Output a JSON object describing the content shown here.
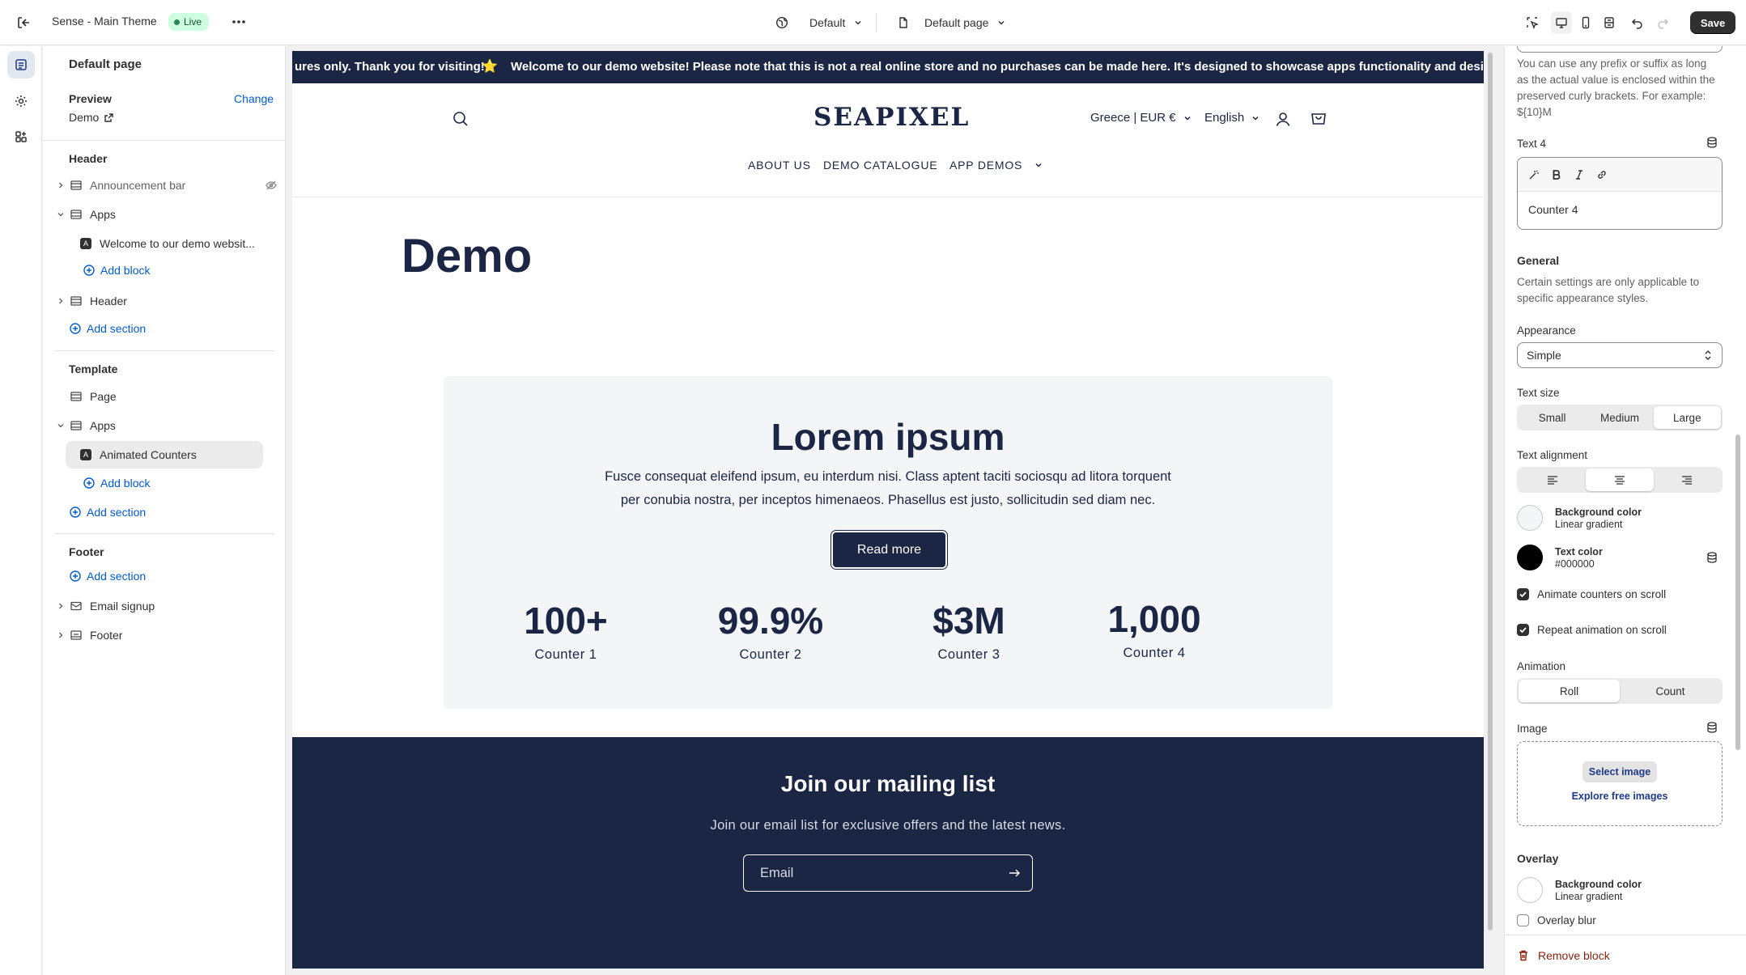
{
  "topbar": {
    "theme_name": "Sense - Main Theme",
    "status": "Live",
    "theme_selector": "Default",
    "page_selector": "Default page",
    "save_label": "Save"
  },
  "sidebar": {
    "title": "Default page",
    "preview_label": "Preview",
    "change_label": "Change",
    "preview_value": "Demo",
    "header_group": "Header",
    "header_items": [
      {
        "label": "Announcement bar"
      },
      {
        "label": "Apps"
      },
      {
        "label": "Welcome to our demo websit..."
      },
      {
        "label": "Add block"
      },
      {
        "label": "Header"
      },
      {
        "label": "Add section"
      }
    ],
    "template_group": "Template",
    "template_items": [
      {
        "label": "Page"
      },
      {
        "label": "Apps"
      },
      {
        "label": "Animated Counters"
      },
      {
        "label": "Add block"
      },
      {
        "label": "Add section"
      }
    ],
    "footer_group": "Footer",
    "footer_items": [
      {
        "label": "Add section"
      },
      {
        "label": "Email signup"
      },
      {
        "label": "Footer"
      }
    ]
  },
  "preview": {
    "announcement_part1": "ures only. Thank you for visiting!",
    "announcement_star": "⭐",
    "announcement_part2": "Welcome to our demo website! Please note that this is not a real online store and no purchases can be made here. It's designed to showcase apps functionality and design feat",
    "logo": "SEAPIXEL",
    "country": "Greece | EUR €",
    "language": "English",
    "nav": [
      "ABOUT US",
      "DEMO CATALOGUE",
      "APP DEMOS"
    ],
    "page_title": "Demo",
    "card": {
      "heading": "Lorem ipsum",
      "text_line1": "Fusce consequat eleifend ipsum, eu interdum nisi. Class aptent taciti sociosqu ad litora torquent",
      "text_line2": "per conubia nostra, per inceptos himenaeos. Phasellus est justo, sollicitudin sed diam nec.",
      "button": "Read more",
      "counters": [
        {
          "value": "100+",
          "label": "Counter 1"
        },
        {
          "value": "99.9%",
          "label": "Counter 2"
        },
        {
          "value": "$3M",
          "label": "Counter 3"
        },
        {
          "value": "1,000",
          "label": "Counter 4"
        }
      ]
    },
    "mailing": {
      "heading": "Join our mailing list",
      "text": "Join our email list for exclusive offers and the latest news.",
      "placeholder": "Email"
    }
  },
  "settings": {
    "help_text_line1": "You can use any prefix or suffix as long",
    "help_text_line2": "as the actual value is enclosed within the",
    "help_text_line3": "preserved curly brackets. For example:",
    "help_text_line4": "${10}M",
    "text4_label": "Text 4",
    "text4_value": "Counter 4",
    "general_heading": "General",
    "general_help_line1": "Certain settings are only applicable to",
    "general_help_line2": "specific appearance styles.",
    "appearance_label": "Appearance",
    "appearance_value": "Simple",
    "text_size_label": "Text size",
    "text_size_options": [
      "Small",
      "Medium",
      "Large"
    ],
    "text_size_selected": "Large",
    "text_alignment_label": "Text alignment",
    "bg_color_label": "Background color",
    "bg_color_value": "Linear gradient",
    "text_color_label": "Text color",
    "text_color_value": "#000000",
    "animate_label": "Animate counters on scroll",
    "repeat_label": "Repeat animation on scroll",
    "animation_label": "Animation",
    "animation_options": [
      "Roll",
      "Count"
    ],
    "animation_selected": "Roll",
    "image_label": "Image",
    "select_image": "Select image",
    "explore_images": "Explore free images",
    "overlay_heading": "Overlay",
    "overlay_bg_label": "Background color",
    "overlay_bg_value": "Linear gradient",
    "overlay_blur_label": "Overlay blur",
    "remove_block": "Remove block"
  },
  "colors": {
    "brand_navy": "#1b2544",
    "link_blue": "#005bd3",
    "save_bg": "#303030",
    "danger": "#8e1f0b"
  }
}
